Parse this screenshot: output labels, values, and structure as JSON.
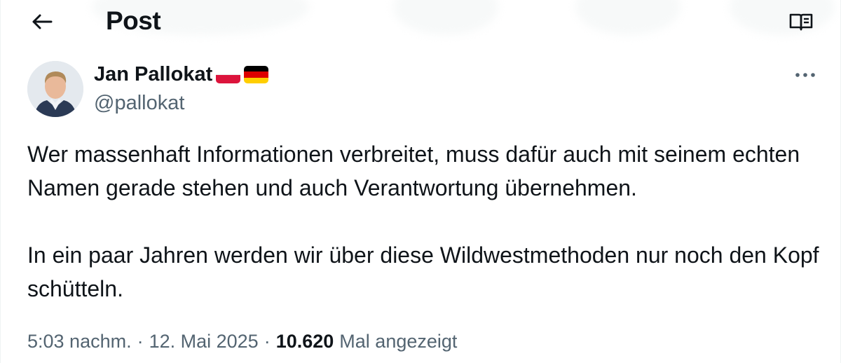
{
  "header": {
    "title": "Post",
    "back_icon": "arrow-left-icon",
    "reader_icon": "open-book-icon"
  },
  "author": {
    "name": "Jan Pallokat",
    "handle": "@pallokat",
    "flags": [
      "Poland",
      "Germany"
    ]
  },
  "post": {
    "paragraphs": [
      "Wer massenhaft Informationen verbreitet, muss dafür auch mit seinem echten Namen gerade stehen und auch Verantwortung übernehmen.",
      "In ein paar Jahren werden wir über diese Wildwestmethoden nur noch den Kopf schütteln."
    ],
    "time": "5:03 nachm.",
    "date": "12. Mai 2025",
    "separator": "·",
    "views_count": "10.620",
    "views_label": "Mal angezeigt"
  },
  "colors": {
    "text_primary": "#0f1419",
    "text_secondary": "#536471",
    "flag_poland": [
      "#ffffff",
      "#dc143c"
    ],
    "flag_germany": [
      "#000000",
      "#dd0000",
      "#ffce00"
    ]
  }
}
